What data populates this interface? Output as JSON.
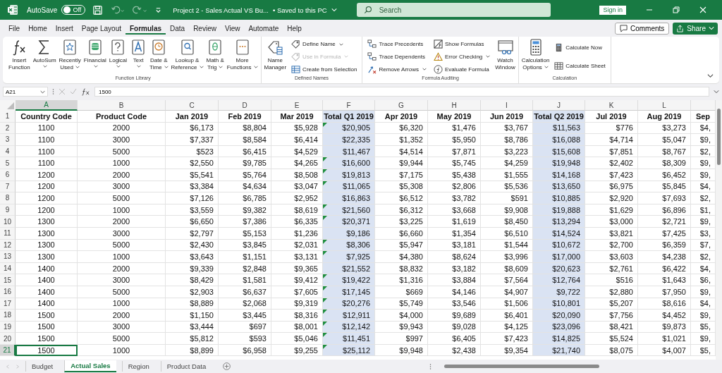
{
  "title_bar": {
    "autosave_label": "AutoSave",
    "autosave": {
      "label": "Off",
      "on": false
    },
    "document_title": "Project 2 - Sales Actual VS Bu...",
    "save_status": "• Saved to this PC",
    "search": {
      "placeholder": "Search"
    },
    "sign_in": "Sign in"
  },
  "menu": {
    "tabs": [
      {
        "label": "File",
        "selected": false
      },
      {
        "label": "Home",
        "selected": false
      },
      {
        "label": "Insert",
        "selected": false
      },
      {
        "label": "Page Layout",
        "selected": false
      },
      {
        "label": "Formulas",
        "selected": true
      },
      {
        "label": "Data",
        "selected": false
      },
      {
        "label": "Review",
        "selected": false
      },
      {
        "label": "View",
        "selected": false
      },
      {
        "label": "Automate",
        "selected": false
      },
      {
        "label": "Help",
        "selected": false
      }
    ],
    "comments": "Comments",
    "share": "Share"
  },
  "ribbon": {
    "groups": [
      {
        "label": "Function Library",
        "items": [
          {
            "kind": "large",
            "lines": [
              "Insert",
              "Function"
            ],
            "dropdown": false,
            "disabled": false
          },
          {
            "kind": "large",
            "lines": [
              "AutoSum"
            ],
            "dropdown": true,
            "disabled": false
          },
          {
            "kind": "large",
            "lines": [
              "Recently",
              "Used"
            ],
            "dropdown": true,
            "disabled": false
          },
          {
            "kind": "large",
            "lines": [
              "Financial"
            ],
            "dropdown": true,
            "disabled": false
          },
          {
            "kind": "large",
            "lines": [
              "Logical"
            ],
            "dropdown": true,
            "disabled": false
          },
          {
            "kind": "large",
            "lines": [
              "Text"
            ],
            "dropdown": true,
            "disabled": false
          },
          {
            "kind": "large",
            "lines": [
              "Date &",
              "Time"
            ],
            "dropdown": true,
            "disabled": false
          },
          {
            "kind": "large",
            "lines": [
              "Lookup &",
              "Reference"
            ],
            "dropdown": true,
            "disabled": false
          },
          {
            "kind": "large",
            "lines": [
              "Math &",
              "Trig"
            ],
            "dropdown": true,
            "disabled": false
          },
          {
            "kind": "large",
            "lines": [
              "More",
              "Functions"
            ],
            "dropdown": true,
            "disabled": false
          }
        ]
      },
      {
        "label": "Defined Names",
        "items": [
          {
            "kind": "large",
            "lines": [
              "Name",
              "Manager"
            ],
            "dropdown": false,
            "disabled": false
          },
          {
            "kind": "small",
            "lines": [
              "Define Name"
            ],
            "dropdown": true,
            "disabled": false
          },
          {
            "kind": "small",
            "lines": [
              "Use in Formula"
            ],
            "dropdown": true,
            "disabled": true
          },
          {
            "kind": "small",
            "lines": [
              "Create from Selection"
            ],
            "dropdown": false,
            "disabled": false
          }
        ]
      },
      {
        "label": "Formula Auditing",
        "items": [
          {
            "kind": "small",
            "lines": [
              "Trace Precedents"
            ],
            "dropdown": false,
            "disabled": false
          },
          {
            "kind": "small",
            "lines": [
              "Trace Dependents"
            ],
            "dropdown": false,
            "disabled": false
          },
          {
            "kind": "small",
            "lines": [
              "Remove Arrows"
            ],
            "dropdown": true,
            "disabled": false
          },
          {
            "kind": "small",
            "lines": [
              "Show Formulas"
            ],
            "dropdown": false,
            "disabled": false
          },
          {
            "kind": "small",
            "lines": [
              "Error Checking"
            ],
            "dropdown": true,
            "disabled": false
          },
          {
            "kind": "small",
            "lines": [
              "Evaluate Formula"
            ],
            "dropdown": false,
            "disabled": false
          },
          {
            "kind": "large",
            "lines": [
              "Watch",
              "Window"
            ],
            "dropdown": false,
            "disabled": false
          }
        ]
      },
      {
        "label": "Calculation",
        "items": [
          {
            "kind": "large",
            "lines": [
              "Calculation",
              "Options"
            ],
            "dropdown": true,
            "disabled": false
          },
          {
            "kind": "small",
            "lines": [
              "Calculate Now"
            ],
            "dropdown": false,
            "disabled": false
          },
          {
            "kind": "small",
            "lines": [
              "Calculate Sheet"
            ],
            "dropdown": false,
            "disabled": false
          }
        ]
      }
    ]
  },
  "formula_bar": {
    "name_box": "A21",
    "formula": "1500"
  },
  "sheet": {
    "columns": [
      {
        "letter": "A",
        "selected": true,
        "shaded": false
      },
      {
        "letter": "B",
        "selected": false,
        "shaded": false
      },
      {
        "letter": "C",
        "selected": false,
        "shaded": false
      },
      {
        "letter": "D",
        "selected": false,
        "shaded": false
      },
      {
        "letter": "E",
        "selected": false,
        "shaded": false
      },
      {
        "letter": "F",
        "selected": false,
        "shaded": true
      },
      {
        "letter": "G",
        "selected": false,
        "shaded": false
      },
      {
        "letter": "H",
        "selected": false,
        "shaded": false
      },
      {
        "letter": "I",
        "selected": false,
        "shaded": false
      },
      {
        "letter": "J",
        "selected": false,
        "shaded": true
      },
      {
        "letter": "K",
        "selected": false,
        "shaded": false
      },
      {
        "letter": "L",
        "selected": false,
        "shaded": false
      },
      {
        "selected": false,
        "shaded": false
      }
    ],
    "rows": [
      {
        "number": "1",
        "kind": "header",
        "selected": false,
        "flagged": false,
        "cells": [
          "Country Code",
          "Product Code",
          "Jan 2019",
          "Feb 2019",
          "Mar 2019",
          "Total Q1 2019",
          "Apr 2019",
          "May 2019",
          "Jun 2019",
          "Total Q2 2019",
          "Jul 2019",
          "Aug 2019",
          "Sep"
        ]
      },
      {
        "number": "2",
        "kind": "data",
        "selected": false,
        "flagged": true,
        "cells": [
          "1100",
          "2000",
          "$6,173",
          "$8,804",
          "$5,928",
          "$20,905",
          "$6,320",
          "$1,476",
          "$3,767",
          "$11,563",
          "$776",
          "$3,273",
          "$4,"
        ]
      },
      {
        "number": "3",
        "kind": "data",
        "selected": false,
        "flagged": false,
        "cells": [
          "1100",
          "3000",
          "$7,337",
          "$8,584",
          "$6,414",
          "$22,335",
          "$1,352",
          "$5,950",
          "$8,786",
          "$16,088",
          "$4,714",
          "$5,047",
          "$9,"
        ]
      },
      {
        "number": "4",
        "kind": "data",
        "selected": false,
        "flagged": false,
        "cells": [
          "1100",
          "5000",
          "$523",
          "$6,415",
          "$4,529",
          "$11,467",
          "$4,514",
          "$7,871",
          "$3,223",
          "$15,608",
          "$7,851",
          "$8,767",
          "$2,"
        ]
      },
      {
        "number": "5",
        "kind": "data",
        "selected": false,
        "flagged": true,
        "cells": [
          "1100",
          "1000",
          "$2,550",
          "$9,785",
          "$4,265",
          "$16,600",
          "$9,944",
          "$5,745",
          "$4,259",
          "$19,948",
          "$2,402",
          "$8,309",
          "$9,"
        ]
      },
      {
        "number": "6",
        "kind": "data",
        "selected": false,
        "flagged": true,
        "cells": [
          "1200",
          "2000",
          "$5,541",
          "$5,764",
          "$8,508",
          "$19,813",
          "$7,175",
          "$5,438",
          "$1,555",
          "$14,168",
          "$7,423",
          "$6,452",
          "$9,"
        ]
      },
      {
        "number": "7",
        "kind": "data",
        "selected": false,
        "flagged": true,
        "cells": [
          "1200",
          "3000",
          "$3,384",
          "$4,634",
          "$3,047",
          "$11,065",
          "$5,308",
          "$2,806",
          "$5,536",
          "$13,650",
          "$6,975",
          "$5,845",
          "$4,"
        ]
      },
      {
        "number": "8",
        "kind": "data",
        "selected": false,
        "flagged": false,
        "cells": [
          "1200",
          "5000",
          "$7,126",
          "$6,785",
          "$2,952",
          "$16,863",
          "$6,512",
          "$3,782",
          "$591",
          "$10,885",
          "$2,920",
          "$7,693",
          "$2,"
        ]
      },
      {
        "number": "9",
        "kind": "data",
        "selected": false,
        "flagged": true,
        "cells": [
          "1200",
          "1000",
          "$3,559",
          "$9,382",
          "$8,619",
          "$21,560",
          "$6,312",
          "$3,668",
          "$9,908",
          "$19,888",
          "$1,629",
          "$6,896",
          "$1,"
        ]
      },
      {
        "number": "10",
        "kind": "data",
        "selected": false,
        "flagged": true,
        "cells": [
          "1300",
          "2000",
          "$6,650",
          "$7,386",
          "$6,335",
          "$20,371",
          "$3,225",
          "$1,619",
          "$8,450",
          "$13,294",
          "$3,000",
          "$2,721",
          "$9,"
        ]
      },
      {
        "number": "11",
        "kind": "data",
        "selected": false,
        "flagged": false,
        "cells": [
          "1300",
          "3000",
          "$2,797",
          "$5,153",
          "$1,236",
          "$9,186",
          "$6,660",
          "$1,354",
          "$6,510",
          "$14,524",
          "$3,821",
          "$7,425",
          "$3,"
        ]
      },
      {
        "number": "12",
        "kind": "data",
        "selected": false,
        "flagged": true,
        "cells": [
          "1300",
          "5000",
          "$2,430",
          "$3,845",
          "$2,031",
          "$8,306",
          "$5,947",
          "$3,181",
          "$1,544",
          "$10,672",
          "$2,700",
          "$6,359",
          "$7,"
        ]
      },
      {
        "number": "13",
        "kind": "data",
        "selected": false,
        "flagged": true,
        "cells": [
          "1300",
          "1000",
          "$3,643",
          "$1,151",
          "$3,131",
          "$7,925",
          "$4,380",
          "$8,624",
          "$3,996",
          "$17,000",
          "$3,603",
          "$4,238",
          "$2,"
        ]
      },
      {
        "number": "14",
        "kind": "data",
        "selected": false,
        "flagged": false,
        "cells": [
          "1400",
          "2000",
          "$9,339",
          "$2,848",
          "$9,365",
          "$21,552",
          "$8,832",
          "$3,182",
          "$8,609",
          "$20,623",
          "$2,761",
          "$6,422",
          "$4,"
        ]
      },
      {
        "number": "15",
        "kind": "data",
        "selected": false,
        "flagged": true,
        "cells": [
          "1400",
          "3000",
          "$8,429",
          "$1,581",
          "$9,412",
          "$19,422",
          "$1,316",
          "$3,884",
          "$7,564",
          "$12,764",
          "$516",
          "$1,643",
          "$6,"
        ]
      },
      {
        "number": "16",
        "kind": "data",
        "selected": false,
        "flagged": true,
        "cells": [
          "1400",
          "5000",
          "$2,903",
          "$6,637",
          "$7,605",
          "$17,145",
          "$669",
          "$4,146",
          "$4,907",
          "$9,722",
          "$2,880",
          "$7,950",
          "$9,"
        ]
      },
      {
        "number": "17",
        "kind": "data",
        "selected": false,
        "flagged": true,
        "cells": [
          "1400",
          "1000",
          "$8,889",
          "$2,068",
          "$9,319",
          "$20,276",
          "$5,749",
          "$3,546",
          "$1,506",
          "$10,801",
          "$5,207",
          "$8,616",
          "$4,"
        ]
      },
      {
        "number": "18",
        "kind": "data",
        "selected": false,
        "flagged": true,
        "cells": [
          "1500",
          "2000",
          "$1,150",
          "$3,445",
          "$8,316",
          "$12,911",
          "$4,000",
          "$9,689",
          "$6,401",
          "$20,090",
          "$7,756",
          "$4,452",
          "$9,"
        ]
      },
      {
        "number": "19",
        "kind": "data",
        "selected": false,
        "flagged": true,
        "cells": [
          "1500",
          "3000",
          "$3,444",
          "$697",
          "$8,001",
          "$12,142",
          "$9,943",
          "$9,028",
          "$4,125",
          "$23,096",
          "$8,421",
          "$9,873",
          "$5,"
        ]
      },
      {
        "number": "20",
        "kind": "data",
        "selected": false,
        "flagged": true,
        "cells": [
          "1500",
          "5000",
          "$5,812",
          "$593",
          "$5,046",
          "$11,451",
          "$997",
          "$6,405",
          "$7,423",
          "$14,825",
          "$5,524",
          "$1,021",
          "$9,"
        ]
      },
      {
        "number": "21",
        "kind": "data",
        "selected": true,
        "flagged": true,
        "cells": [
          "1500",
          "1000",
          "$8,899",
          "$6,958",
          "$9,255",
          "$25,112",
          "$9,948",
          "$2,438",
          "$9,354",
          "$21,740",
          "$8,075",
          "$4,007",
          "$5,"
        ]
      }
    ]
  },
  "sheet_tabs": [
    {
      "label": "Budget",
      "selected": false
    },
    {
      "label": "Actual Sales",
      "selected": true
    },
    {
      "label": "Region",
      "selected": false
    },
    {
      "label": "Product Data",
      "selected": false
    }
  ]
}
